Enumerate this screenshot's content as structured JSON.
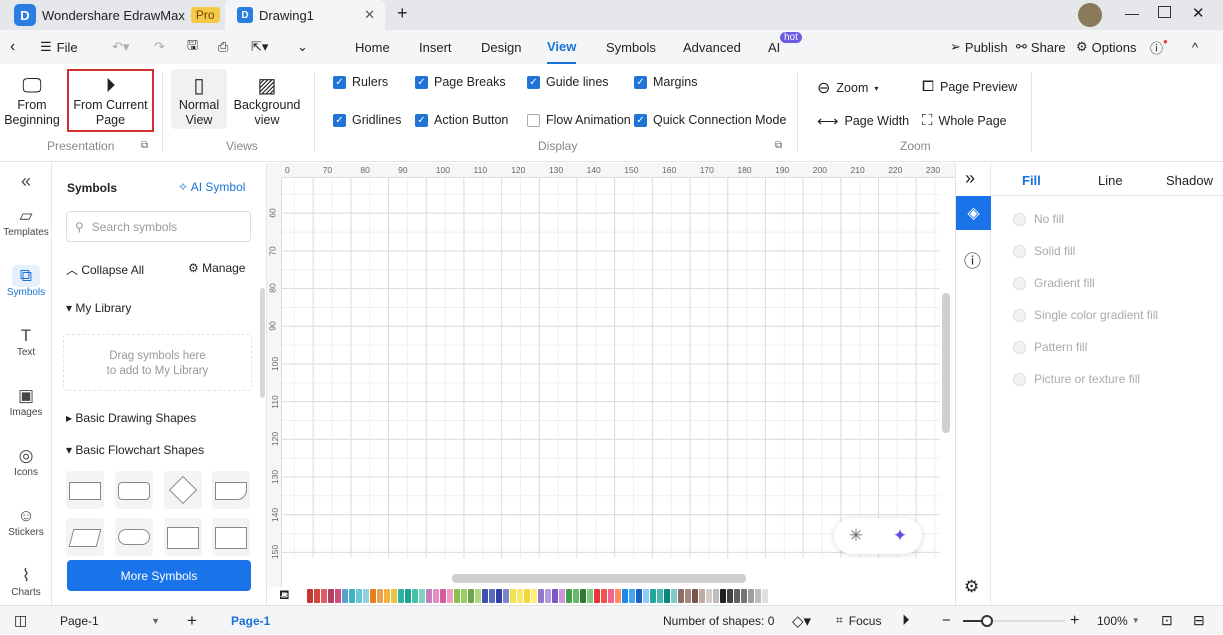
{
  "titlebar": {
    "app_name": "Wondershare EdrawMax",
    "badge": "Pro",
    "doc_tab": "Drawing1"
  },
  "menubar": {
    "file": "File",
    "tabs": [
      "Home",
      "Insert",
      "Design",
      "View",
      "Symbols",
      "Advanced",
      "AI"
    ],
    "active_tab": "View",
    "ai_badge": "hot",
    "publish": "Publish",
    "share": "Share",
    "options": "Options"
  },
  "ribbon": {
    "presentation": {
      "from_beginning": [
        "From",
        "Beginning"
      ],
      "from_current": [
        "From Current",
        "Page"
      ],
      "label": "Presentation"
    },
    "views": {
      "normal": [
        "Normal",
        "View"
      ],
      "background": [
        "Background",
        "view"
      ],
      "label": "Views"
    },
    "display": {
      "label": "Display",
      "checks": [
        {
          "label": "Rulers",
          "checked": true
        },
        {
          "label": "Page Breaks",
          "checked": true
        },
        {
          "label": "Guide lines",
          "checked": true
        },
        {
          "label": "Margins",
          "checked": true
        },
        {
          "label": "Gridlines",
          "checked": true
        },
        {
          "label": "Action Button",
          "checked": true
        },
        {
          "label": "Flow Animation",
          "checked": false
        },
        {
          "label": "Quick Connection Mode",
          "checked": true
        }
      ]
    },
    "zoom": {
      "label": "Zoom",
      "zoom": "Zoom",
      "page_preview": "Page Preview",
      "page_width": "Page Width",
      "whole_page": "Whole Page"
    }
  },
  "leftbar": {
    "items": [
      "Templates",
      "Symbols",
      "Text",
      "Images",
      "Icons",
      "Stickers",
      "Charts"
    ],
    "active": "Symbols"
  },
  "symbols": {
    "title": "Symbols",
    "ai_symbol": "AI Symbol",
    "search_placeholder": "Search symbols",
    "collapse_all": "Collapse All",
    "manage": "Manage",
    "my_library": "My Library",
    "drag_hint": [
      "Drag symbols here",
      "to add to My Library"
    ],
    "basic_drawing": "Basic Drawing Shapes",
    "basic_flowchart": "Basic Flowchart Shapes",
    "more_symbols": "More Symbols"
  },
  "rulers": {
    "top": [
      "0",
      "70",
      "80",
      "90",
      "100",
      "110",
      "120",
      "130",
      "140",
      "150",
      "160",
      "170",
      "180",
      "190",
      "200",
      "210",
      "220",
      "230"
    ],
    "left": [
      "60",
      "70",
      "80",
      "90",
      "100",
      "110",
      "120",
      "130",
      "140",
      "150"
    ]
  },
  "right_panel": {
    "tabs": [
      "Fill",
      "Line",
      "Shadow"
    ],
    "active_tab": "Fill",
    "fill_options": [
      "No fill",
      "Solid fill",
      "Gradient fill",
      "Single color gradient fill",
      "Pattern fill",
      "Picture or texture fill"
    ]
  },
  "palette": [
    "#c0392b",
    "#d64545",
    "#e05a6a",
    "#b04060",
    "#c94f7c",
    "#5aa0c8",
    "#3fb5c9",
    "#68c7d8",
    "#8ed3df",
    "#e67e22",
    "#f0a04b",
    "#f5b041",
    "#e8c547",
    "#2bb3a3",
    "#1fa38f",
    "#44c2a8",
    "#7fd3c0",
    "#c77dbb",
    "#e08fc6",
    "#d35d9c",
    "#f19cc2",
    "#8bc34a",
    "#9ccc65",
    "#6aa84f",
    "#b5d77a",
    "#3f51b5",
    "#5c6bc0",
    "#2f3fa0",
    "#7986cb",
    "#f4e04d",
    "#f7e96b",
    "#f1d53a",
    "#fff176",
    "#9575cd",
    "#b39ddb",
    "#7e57c2",
    "#ce93d8",
    "#43a047",
    "#66bb6a",
    "#2e7d32",
    "#81c784",
    "#e53935",
    "#ef5350",
    "#f06292",
    "#ff8a65",
    "#1e88e5",
    "#42a5f5",
    "#1565c0",
    "#90caf9",
    "#26a69a",
    "#4db6ac",
    "#00897b",
    "#80cbc4",
    "#8d6e63",
    "#a1887f",
    "#795548",
    "#bcaaa4",
    "#d7ccc8",
    "#bdbdbd",
    "#212121",
    "#424242",
    "#616161",
    "#757575",
    "#9e9e9e",
    "#bdbdbd",
    "#e0e0e0"
  ],
  "status": {
    "page_select": "Page-1",
    "page_tab": "Page-1",
    "shapes": "Number of shapes: 0",
    "focus": "Focus",
    "zoom": "100%",
    "zoom_level": 100
  },
  "colors": {
    "accent": "#1a73d9",
    "highlight_box": "#d0312d"
  }
}
